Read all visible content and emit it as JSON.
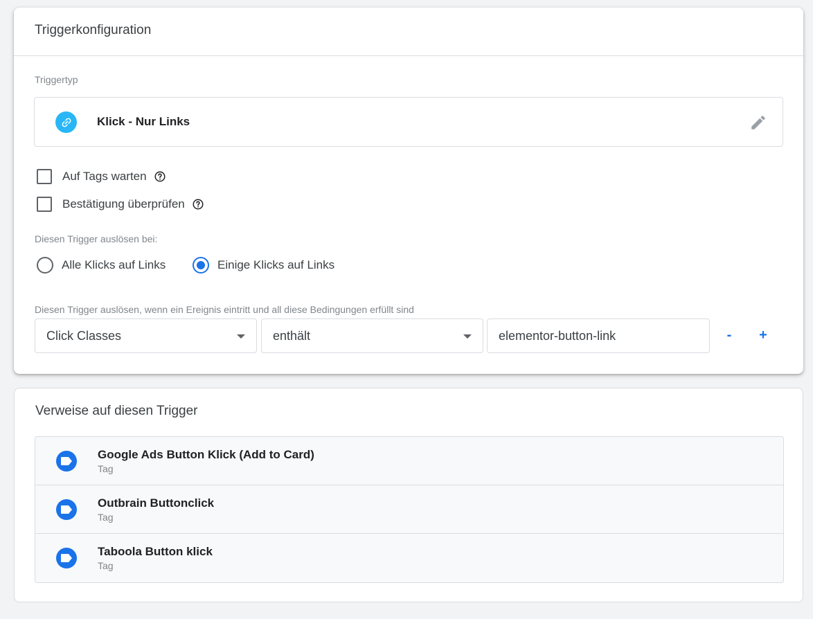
{
  "config": {
    "title": "Triggerkonfiguration",
    "trigger_type_label": "Triggertyp",
    "trigger_type": {
      "name": "Klick - Nur Links",
      "icon": "link-icon",
      "color": "#29b6f6"
    },
    "checkboxes": [
      {
        "label": "Auf Tags warten",
        "checked": false
      },
      {
        "label": "Bestätigung überprüfen",
        "checked": false
      }
    ],
    "fire_on_label": "Diesen Trigger auslösen bei:",
    "fire_on_options": [
      {
        "label": "Alle Klicks auf Links",
        "selected": false
      },
      {
        "label": "Einige Klicks auf Links",
        "selected": true
      }
    ],
    "conditions_label": "Diesen Trigger auslösen, wenn ein Ereignis eintritt und all diese Bedingungen erfüllt sind",
    "condition": {
      "variable": "Click Classes",
      "operator": "enthält",
      "value": "elementor-button-link",
      "remove_label": "-",
      "add_label": "+"
    }
  },
  "references": {
    "title": "Verweise auf diesen Trigger",
    "items": [
      {
        "name": "Google Ads Button Klick (Add to Card)",
        "type": "Tag"
      },
      {
        "name": "Outbrain Buttonclick",
        "type": "Tag"
      },
      {
        "name": "Taboola Button klick",
        "type": "Tag"
      }
    ],
    "icon": "tag-icon",
    "accent": "#1a73e8"
  }
}
